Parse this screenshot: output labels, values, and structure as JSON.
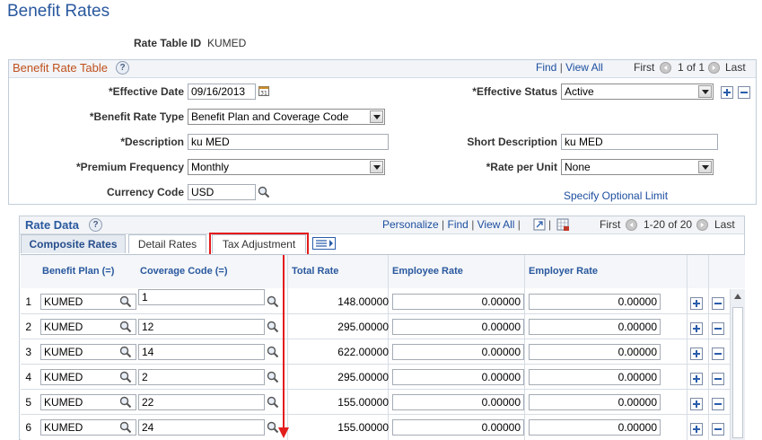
{
  "page": {
    "title": "Benefit Rates"
  },
  "header": {
    "rate_table_id_label": "Rate Table ID",
    "rate_table_id_value": "KUMED"
  },
  "benefit_rate_table": {
    "title": "Benefit Rate Table",
    "nav": {
      "find": "Find",
      "view_all": "View All",
      "first": "First",
      "range": "1 of 1",
      "last": "Last"
    },
    "effective_date_label": "*Effective Date",
    "effective_date_value": "09/16/2013",
    "effective_status_label": "*Effective Status",
    "effective_status_value": "Active",
    "benefit_rate_type_label": "*Benefit Rate Type",
    "benefit_rate_type_value": "Benefit Plan and Coverage Code",
    "description_label": "*Description",
    "description_value": "ku MED",
    "short_description_label": "Short Description",
    "short_description_value": "ku MED",
    "premium_frequency_label": "*Premium Frequency",
    "premium_frequency_value": "Monthly",
    "rate_per_unit_label": "*Rate per Unit",
    "rate_per_unit_value": "None",
    "currency_code_label": "Currency Code",
    "currency_code_value": "USD",
    "specify_optional_limit": "Specify Optional Limit"
  },
  "rate_data": {
    "title": "Rate Data",
    "nav": {
      "personalize": "Personalize",
      "find": "Find",
      "view_all": "View All",
      "first": "First",
      "range": "1-20 of 20",
      "last": "Last"
    },
    "tabs": [
      {
        "label": "Composite Rates",
        "active": true
      },
      {
        "label": "Detail Rates",
        "active": false
      },
      {
        "label": "Tax Adjustment",
        "active": false
      }
    ],
    "columns": [
      "Benefit Plan (=)",
      "Coverage Code (=)",
      "Total Rate",
      "Employee Rate",
      "Employer Rate"
    ],
    "rows": [
      {
        "num": "1",
        "plan": "KUMED",
        "coverage": "1",
        "total": "148.00000",
        "employee": "0.00000",
        "employer": "0.00000"
      },
      {
        "num": "2",
        "plan": "KUMED",
        "coverage": "12",
        "total": "295.00000",
        "employee": "0.00000",
        "employer": "0.00000"
      },
      {
        "num": "3",
        "plan": "KUMED",
        "coverage": "14",
        "total": "622.00000",
        "employee": "0.00000",
        "employer": "0.00000"
      },
      {
        "num": "4",
        "plan": "KUMED",
        "coverage": "2",
        "total": "295.00000",
        "employee": "0.00000",
        "employer": "0.00000"
      },
      {
        "num": "5",
        "plan": "KUMED",
        "coverage": "22",
        "total": "155.00000",
        "employee": "0.00000",
        "employer": "0.00000"
      },
      {
        "num": "6",
        "plan": "KUMED",
        "coverage": "24",
        "total": "155.00000",
        "employee": "0.00000",
        "employer": "0.00000"
      }
    ]
  },
  "colors": {
    "title_blue": "#29589e",
    "link_blue": "#1d4fa0",
    "group_title": "#c0501c",
    "highlight_red": "#e31c1c"
  }
}
